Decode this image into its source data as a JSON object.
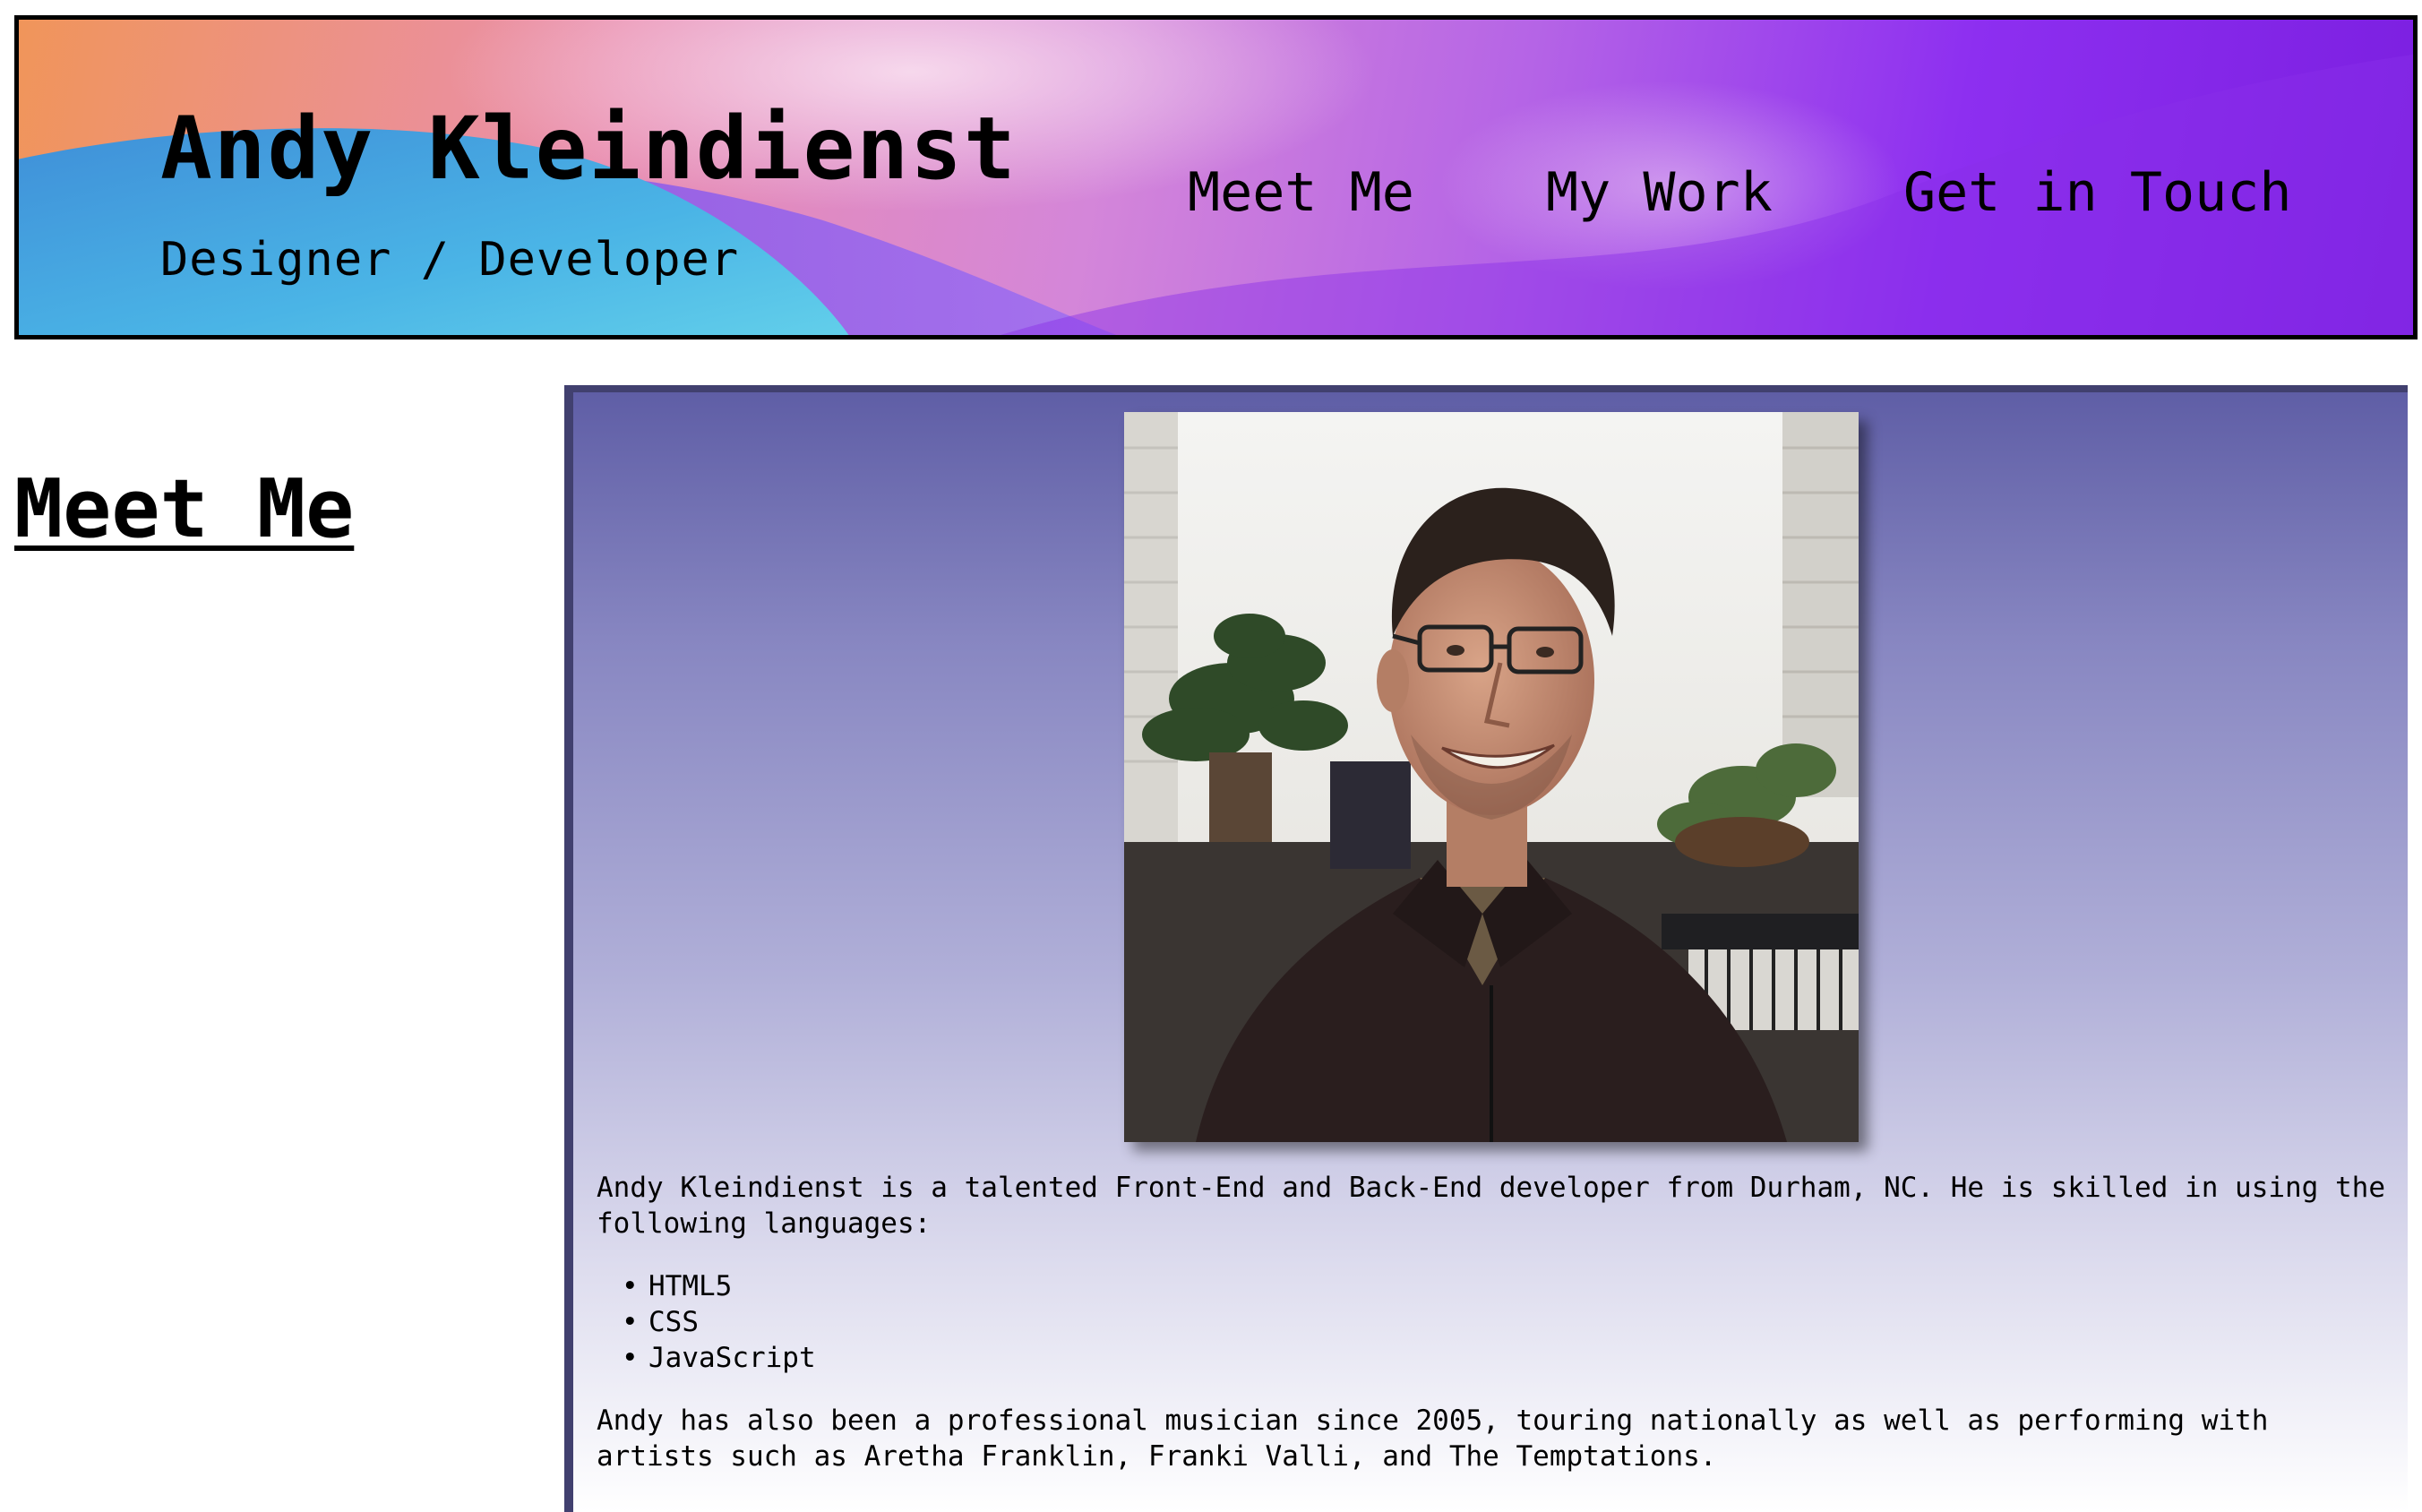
{
  "header": {
    "name": "Andy Kleindienst",
    "tagline": "Designer / Developer",
    "nav": [
      {
        "label": "Meet Me"
      },
      {
        "label": "My Work"
      },
      {
        "label": "Get in Touch"
      }
    ]
  },
  "section": {
    "heading": "Meet Me"
  },
  "about": {
    "intro": "Andy Kleindienst is a talented Front-End and Back-End developer from Durham, NC. He is skilled in using the following languages:",
    "languages": [
      "HTML5",
      "CSS",
      "JavaScript"
    ],
    "music": "Andy has also been a professional musician since 2005, touring nationally as well as performing with artists such as Aretha Franklin, Franki Valli, and The Temptations."
  },
  "colors": {
    "header_gradient": [
      "#f0955a",
      "#e98eb0",
      "#d486d9",
      "#8d2ff0",
      "#7b1fe0"
    ],
    "panel_border": "#41406f",
    "panel_gradient_top": "#5f5ea6",
    "panel_gradient_bottom": "#ffffff"
  }
}
